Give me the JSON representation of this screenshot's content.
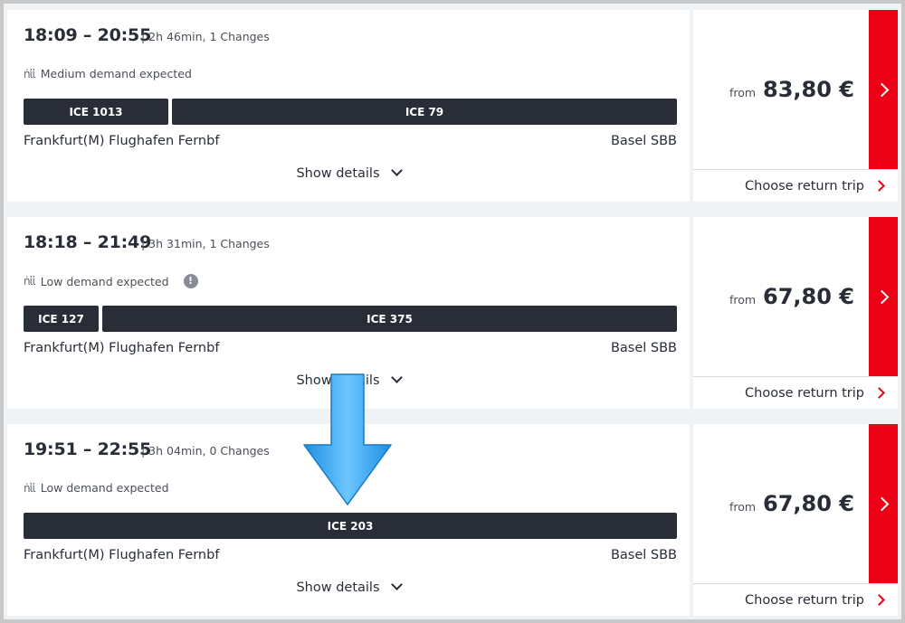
{
  "colors": {
    "accent": "#ec0016",
    "bar": "#282d37",
    "text": "#282d37",
    "muted": "#4b4f58"
  },
  "connections": [
    {
      "time": "18:09 – 20:55",
      "duration": "| 2h 46min, 1 Changes",
      "demand": "Medium demand expected",
      "demand_icon": "occupancy-icon",
      "show_info": false,
      "trains": [
        "ICE 1013",
        "ICE 79"
      ],
      "origin": "Frankfurt(M) Flughafen Fernbf",
      "destination": "Basel SBB",
      "details_label": "Show details",
      "from_label": "from",
      "price": "83,80 €",
      "return_label": "Choose return trip"
    },
    {
      "time": "18:18 – 21:49",
      "duration": "| 3h 31min, 1 Changes",
      "demand": "Low demand expected",
      "demand_icon": "occupancy-icon",
      "show_info": true,
      "info_symbol": "!",
      "trains": [
        "ICE 127",
        "ICE 375"
      ],
      "origin": "Frankfurt(M) Flughafen Fernbf",
      "destination": "Basel SBB",
      "details_label": "Show details",
      "from_label": "from",
      "price": "67,80 €",
      "return_label": "Choose return trip"
    },
    {
      "time": "19:51 – 22:55",
      "duration": "| 3h 04min, 0 Changes",
      "demand": "Low demand expected",
      "demand_icon": "occupancy-icon",
      "show_info": false,
      "trains": [
        "ICE 203"
      ],
      "origin": "Frankfurt(M) Flughafen Fernbf",
      "destination": "Basel SBB",
      "details_label": "Show details",
      "from_label": "from",
      "price": "67,80 €",
      "return_label": "Choose return trip"
    }
  ],
  "overlay": {
    "arrow": "down-arrow-icon",
    "arrow_color": "#3fa9f5"
  }
}
